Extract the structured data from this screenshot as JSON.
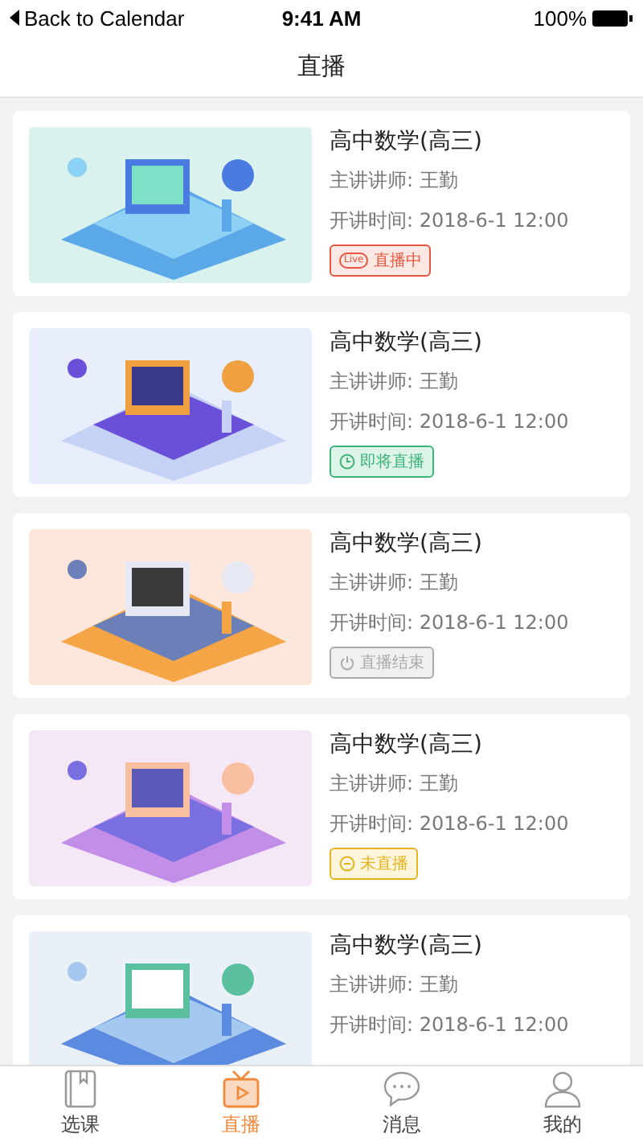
{
  "status_bar": {
    "back": "Back to Calendar",
    "time": "9:41 AM",
    "battery": "100%"
  },
  "nav": {
    "title": "直播"
  },
  "courses": [
    {
      "title": "高中数学(高三)",
      "teacher": "主讲讲师: 王勤",
      "time": "开讲时间: 2018-6-1 12:00",
      "status": {
        "kind": "live",
        "label": "直播中",
        "icon_text": "Live"
      }
    },
    {
      "title": "高中数学(高三)",
      "teacher": "主讲讲师: 王勤",
      "time": "开讲时间: 2018-6-1 12:00",
      "status": {
        "kind": "upcoming",
        "label": "即将直播"
      }
    },
    {
      "title": "高中数学(高三)",
      "teacher": "主讲讲师: 王勤",
      "time": "开讲时间: 2018-6-1 12:00",
      "status": {
        "kind": "ended",
        "label": "直播结束"
      }
    },
    {
      "title": "高中数学(高三)",
      "teacher": "主讲讲师: 王勤",
      "time": "开讲时间: 2018-6-1 12:00",
      "status": {
        "kind": "pending",
        "label": "未直播"
      }
    },
    {
      "title": "高中数学(高三)",
      "teacher": "主讲讲师: 王勤",
      "time": "开讲时间: 2018-6-1 12:00"
    }
  ],
  "tabs": [
    {
      "kind": "book",
      "label": "选课",
      "selected": false
    },
    {
      "kind": "tv",
      "label": "直播",
      "selected": true
    },
    {
      "kind": "chat",
      "label": "消息",
      "selected": false
    },
    {
      "kind": "person",
      "label": "我的",
      "selected": false
    }
  ]
}
